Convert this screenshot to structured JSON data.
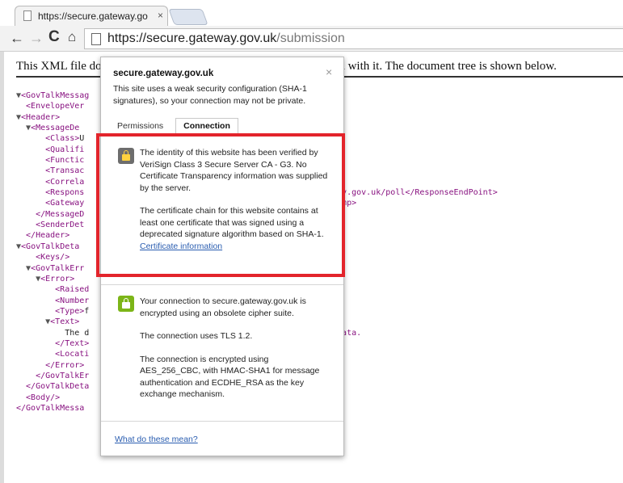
{
  "browser": {
    "tab_title": "https://secure.gateway.go",
    "tab_close": "×",
    "url_host": "https://secure.gateway.gov.uk",
    "url_path": "/submission",
    "back": "←",
    "forward": "→",
    "reload": "C",
    "home": "⌂"
  },
  "page": {
    "notice_left": "This XML file do",
    "notice_right": "iated with it. The document tree is shown below.",
    "tree_lines": [
      {
        "a": "▼",
        "t": "<GovTalkMessag",
        "x": "",
        "e": "",
        "r": "e\">"
      },
      {
        "a": "",
        "t": "  <EnvelopeVer",
        "x": "",
        "e": "",
        "r": ""
      },
      {
        "a": "▼",
        "t": "<Header>",
        "x": "",
        "e": "",
        "r": ""
      },
      {
        "a": "  ▼",
        "t": "<MessageDe",
        "x": "",
        "e": "",
        "r": ""
      },
      {
        "a": "",
        "t": "      <Class>",
        "x": "U",
        "e": "",
        "r": ""
      },
      {
        "a": "",
        "t": "      <Qualifi",
        "x": "",
        "e": "",
        "r": ""
      },
      {
        "a": "",
        "t": "      <Functic",
        "x": "",
        "e": "",
        "r": ""
      },
      {
        "a": "",
        "t": "      <Transac",
        "x": "",
        "e": "",
        "r": ""
      },
      {
        "a": "",
        "t": "      <Correla",
        "x": "",
        "e": "",
        "r": ""
      },
      {
        "a": "",
        "t": "      <Respons",
        "x": "",
        "e": "",
        "r": "eway.gov.uk/poll</ResponseEndPoint>"
      },
      {
        "a": "",
        "t": "      <Gateway",
        "x": "",
        "e": "",
        "r": "stamp>"
      },
      {
        "a": "",
        "t": "    </MessageD",
        "x": "",
        "e": "",
        "r": ""
      },
      {
        "a": "",
        "t": "    <SenderDet",
        "x": "",
        "e": "",
        "r": ""
      },
      {
        "a": "",
        "t": "  </Header>",
        "x": "",
        "e": "",
        "r": ""
      },
      {
        "a": "▼",
        "t": "<GovTalkDeta",
        "x": "",
        "e": "",
        "r": ""
      },
      {
        "a": "",
        "t": "    <Keys/>",
        "x": "",
        "e": "",
        "r": ""
      },
      {
        "a": "  ▼",
        "t": "<GovTalkErr",
        "x": "",
        "e": "",
        "r": ""
      },
      {
        "a": "    ▼",
        "t": "<Error>",
        "x": "",
        "e": "",
        "r": ""
      },
      {
        "a": "",
        "t": "        <Raised",
        "x": "",
        "e": "",
        "r": ""
      },
      {
        "a": "",
        "t": "        <Number",
        "x": "",
        "e": "",
        "r": ""
      },
      {
        "a": "",
        "t": "        <Type>",
        "x": "f",
        "e": "",
        "r": ""
      },
      {
        "a": "      ▼",
        "t": "<Text>",
        "x": "",
        "e": "",
        "r": ""
      },
      {
        "a": "",
        "t": "",
        "x": "          The d",
        "e": "",
        "r": "d data."
      },
      {
        "a": "",
        "t": "        </Text>",
        "x": "",
        "e": "",
        "r": ""
      },
      {
        "a": "",
        "t": "        <Locati",
        "x": "",
        "e": "",
        "r": ""
      },
      {
        "a": "",
        "t": "      </Error>",
        "x": "",
        "e": "",
        "r": ""
      },
      {
        "a": "",
        "t": "    </GovTalkEr",
        "x": "",
        "e": "",
        "r": ""
      },
      {
        "a": "",
        "t": "  </GovTalkDeta",
        "x": "",
        "e": "",
        "r": ""
      },
      {
        "a": "",
        "t": "  <Body/>",
        "x": "",
        "e": "",
        "r": ""
      },
      {
        "a": "",
        "t": "</GovTalkMessa",
        "x": "",
        "e": "",
        "r": ""
      }
    ]
  },
  "popup": {
    "host": "secure.gateway.gov.uk",
    "close": "×",
    "warning": "This site uses a weak security configuration (SHA-1 signatures), so your connection may not be private.",
    "tab_permissions": "Permissions",
    "tab_connection": "Connection",
    "identity_p1": "The identity of this website has been verified by VeriSign Class 3 Secure Server CA - G3. No Certificate Transparency information was supplied by the server.",
    "identity_p2": "The certificate chain for this website contains at least one certificate that was signed using a deprecated signature algorithm based on SHA-1.",
    "cert_link": "Certificate information",
    "conn_p1": "Your connection to secure.gateway.gov.uk is encrypted using an obsolete cipher suite.",
    "conn_p2": "The connection uses TLS 1.2.",
    "conn_p3": "The connection is encrypted using AES_256_CBC, with HMAC-SHA1 for message authentication and ECDHE_RSA as the key exchange mechanism.",
    "help_link": "What do these mean?"
  },
  "colors": {
    "highlight": "#e3242b",
    "lock_ok": "#7cb518",
    "lock_warn": "#6d6d6d",
    "link": "#2a5db0",
    "xml_tag": "#881280"
  }
}
